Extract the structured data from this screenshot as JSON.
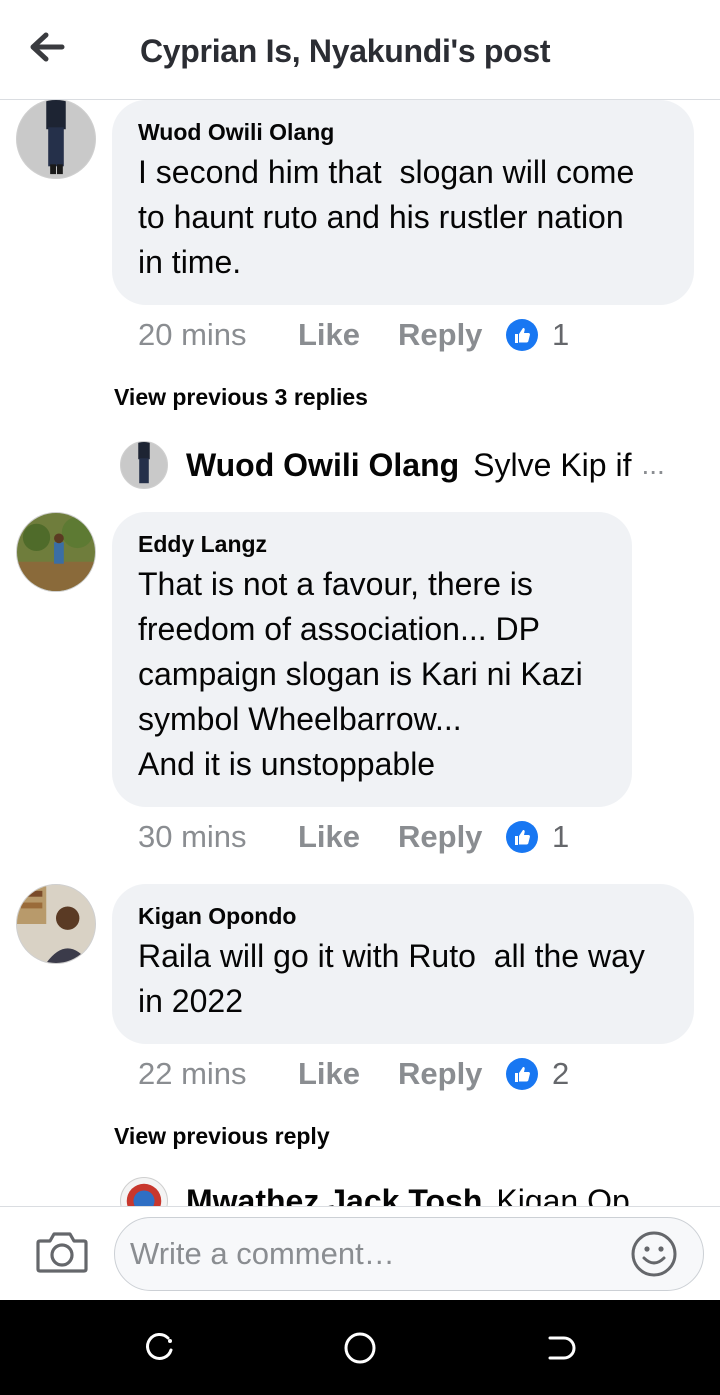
{
  "header": {
    "title": "Cyprian Is, Nyakundi's post",
    "back_icon": "arrow-left-icon"
  },
  "comments": [
    {
      "author": "Wuod Owili Olang",
      "text": "I second him that  slogan will come\nto haunt ruto and his rustler nation\nin time.",
      "time": "20 mins",
      "like_label": "Like",
      "reply_label": "Reply",
      "like_count": "1"
    },
    {
      "author": "Eddy Langz",
      "text": "That is not a favour, there is\nfreedom of association... DP\ncampaign slogan is Kari ni Kazi\nsymbol Wheelbarrow...\nAnd it is unstoppable",
      "time": "30 mins",
      "like_label": "Like",
      "reply_label": "Reply",
      "like_count": "1"
    },
    {
      "author": "Kigan Opondo",
      "text": "Raila will go it with Ruto  all the way\nin 2022",
      "time": "22 mins",
      "like_label": "Like",
      "reply_label": "Reply",
      "like_count": "2"
    }
  ],
  "reply_threads": [
    {
      "view_previous_label": "View previous 3 replies",
      "preview_author": "Wuod Owili Olang",
      "preview_text": "Sylve Kip if",
      "ellipsis": "..."
    },
    {
      "view_previous_label": "View previous reply",
      "preview_author": "Mwathez Jack Tosh",
      "preview_text": "Kigan Op"
    }
  ],
  "composer": {
    "placeholder": "Write a comment…",
    "camera_icon": "camera-icon",
    "emoji_icon": "emoji-icon"
  },
  "colors": {
    "like_blue": "#1877f2",
    "bubble_bg": "#f0f2f5",
    "muted_text": "#8a8d91"
  }
}
